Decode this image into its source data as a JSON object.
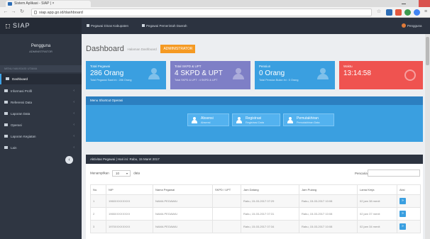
{
  "browser": {
    "tab_title": "Sistem Aplikasi - SIAP | ×",
    "url": "siap.app.go.id/dashboard",
    "colors": {
      "close": "#d9534f"
    }
  },
  "app": {
    "brand": "SIAP",
    "nav_links": [
      "Pegawai Dinas Kabupaten",
      "Pegawai Pemerintah Daerah"
    ],
    "user_label": "Pengguna"
  },
  "sidebar": {
    "profile_name": "Pengguna",
    "profile_role": "ADMINISTRATOR",
    "search_label": "MENU NAVIGASI UTAMA",
    "items": [
      {
        "label": "Dashboard",
        "icon": "dashboard-icon",
        "active": true
      },
      {
        "label": "Informasi Profil",
        "icon": "user-icon"
      },
      {
        "label": "Referensi Data",
        "icon": "book-icon"
      },
      {
        "label": "Laporan Data",
        "icon": "chart-icon"
      },
      {
        "label": "Operasi",
        "icon": "list-icon"
      },
      {
        "label": "Laporan Kegiatan",
        "icon": "bar-chart-icon"
      },
      {
        "label": "Lain",
        "icon": "grid-icon"
      }
    ]
  },
  "page": {
    "title": "Dashboard",
    "subtitle": "Halaman Dashboard",
    "role": "ADMINISTRATOR"
  },
  "stats": [
    {
      "label": "Total Pegawai",
      "value": "286 Orang",
      "footer": "Total Pegawai Saat ini : 286 Orang",
      "color": "#3a9fe0",
      "icon": "users-icon"
    },
    {
      "label": "Total SKPD & UPT",
      "value": "4 SKPD & UPT",
      "footer": "Total SKPD & UPT : 4 SKPD & UPT",
      "color": "#7e7fc6",
      "icon": "users-icon"
    },
    {
      "label": "Pensiun",
      "value": "0 Orang",
      "footer": "Total Pensiun Bulan Ini : 0 Orang",
      "color": "#3a9fe0",
      "icon": "user-icon"
    },
    {
      "label": "Waktu",
      "value": "13:14:58",
      "footer": "",
      "color": "#ef5350",
      "icon": "clock-icon"
    }
  ],
  "menu_panel": {
    "heading": "Menu Shortcut Operasi",
    "buttons": [
      {
        "label": "Absensi",
        "sub": "Absensi",
        "icon": "user-icon"
      },
      {
        "label": "Registrasi",
        "sub": "Registrasi Data",
        "icon": "users-icon"
      },
      {
        "label": "Pemutakhiran",
        "sub": "Pemutakhiran Data",
        "icon": "users-icon"
      }
    ]
  },
  "table_panel": {
    "heading": "Aktivitas Pegawai | Hari ini: Rabu, 15 Maret 2017",
    "show_label": "Menampilkan",
    "show_value": "10",
    "entries_label": "data",
    "search_label": "Pencarian:",
    "search_value": "",
    "columns": [
      "No.",
      "NIP",
      "Nama Pegawai",
      "SKPD / UPT",
      "Jam Datang",
      "Jam Pulang",
      "Lama Kerja",
      "Aksi"
    ],
    "rows": [
      [
        "1",
        "1960XXXXXXXX",
        "NAMA PEGAWAI",
        "",
        "Rabu, 15-03-2017 07:29",
        "Rabu, 15-03-2017 10:08",
        "02 jam 38 menit",
        "»"
      ],
      [
        "2",
        "1965XXXXXXXX",
        "NAMA PEGAWAI",
        "",
        "Rabu, 15-03-2017 07:31",
        "Rabu, 15-03-2017 10:08",
        "02 jam 37 menit",
        "»"
      ],
      [
        "3",
        "1970XXXXXXXX",
        "NAMA PEGAWAI",
        "",
        "Rabu, 15-03-2017 07:34",
        "Rabu, 15-03-2017 10:08",
        "02 jam 34 menit",
        "»"
      ]
    ]
  }
}
